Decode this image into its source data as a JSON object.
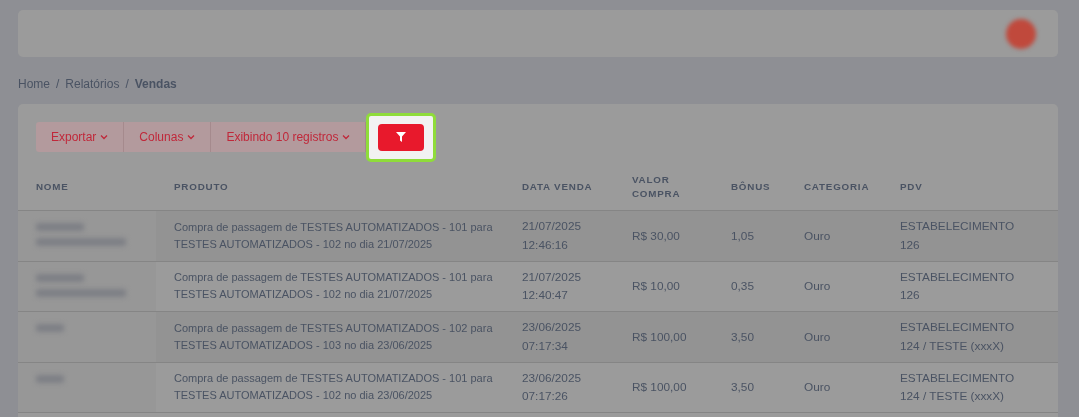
{
  "header": {
    "avatar": {
      "kind": "blurred"
    }
  },
  "breadcrumb_separator": "/",
  "breadcrumb": [
    {
      "label": "Home",
      "current": false
    },
    {
      "label": "Relatórios",
      "current": false
    },
    {
      "label": "Vendas",
      "current": true
    }
  ],
  "toolbar": {
    "buttons": [
      {
        "label": "Exportar"
      },
      {
        "label": "Colunas"
      },
      {
        "label": "Exibindo 10 registros"
      }
    ],
    "filter_button": {
      "highlighted": true
    }
  },
  "table": {
    "columns": [
      "NOME",
      "PRODUTO",
      "DATA VENDA",
      "VALOR COMPRA",
      "BÔNUS",
      "CATEGORIA",
      "PDV"
    ],
    "rows": [
      {
        "name": {
          "kind": "long"
        },
        "produto": "Compra de passagem de TESTES AUTOMATIZADOS - 101 para TESTES AUTOMATIZADOS - 102 no dia 21/07/2025",
        "data": [
          "21/07/2025",
          "12:46:16"
        ],
        "valor": "R$ 30,00",
        "bonus": "1,05",
        "categoria": "Ouro",
        "pdv": "ESTABELECIMENTO 126"
      },
      {
        "name": {
          "kind": "long"
        },
        "produto": "Compra de passagem de TESTES AUTOMATIZADOS - 101 para TESTES AUTOMATIZADOS - 102 no dia 21/07/2025",
        "data": [
          "21/07/2025",
          "12:40:47"
        ],
        "valor": "R$ 10,00",
        "bonus": "0,35",
        "categoria": "Ouro",
        "pdv": "ESTABELECIMENTO 126"
      },
      {
        "name": {
          "kind": "short"
        },
        "produto": "Compra de passagem de TESTES AUTOMATIZADOS - 102 para TESTES AUTOMATIZADOS - 103 no dia 23/06/2025",
        "data": [
          "23/06/2025",
          "07:17:34"
        ],
        "valor": "R$ 100,00",
        "bonus": "3,50",
        "categoria": "Ouro",
        "pdv": "ESTABELECIMENTO 124 / TESTE (xxxX)"
      },
      {
        "name": {
          "kind": "short"
        },
        "produto": "Compra de passagem de TESTES AUTOMATIZADOS - 101 para TESTES AUTOMATIZADOS - 102 no dia 23/06/2025",
        "data": [
          "23/06/2025",
          "07:17:26"
        ],
        "valor": "R$ 100,00",
        "bonus": "3,50",
        "categoria": "Ouro",
        "pdv": "ESTABELECIMENTO 124 / TESTE (xxxX)"
      }
    ]
  }
}
